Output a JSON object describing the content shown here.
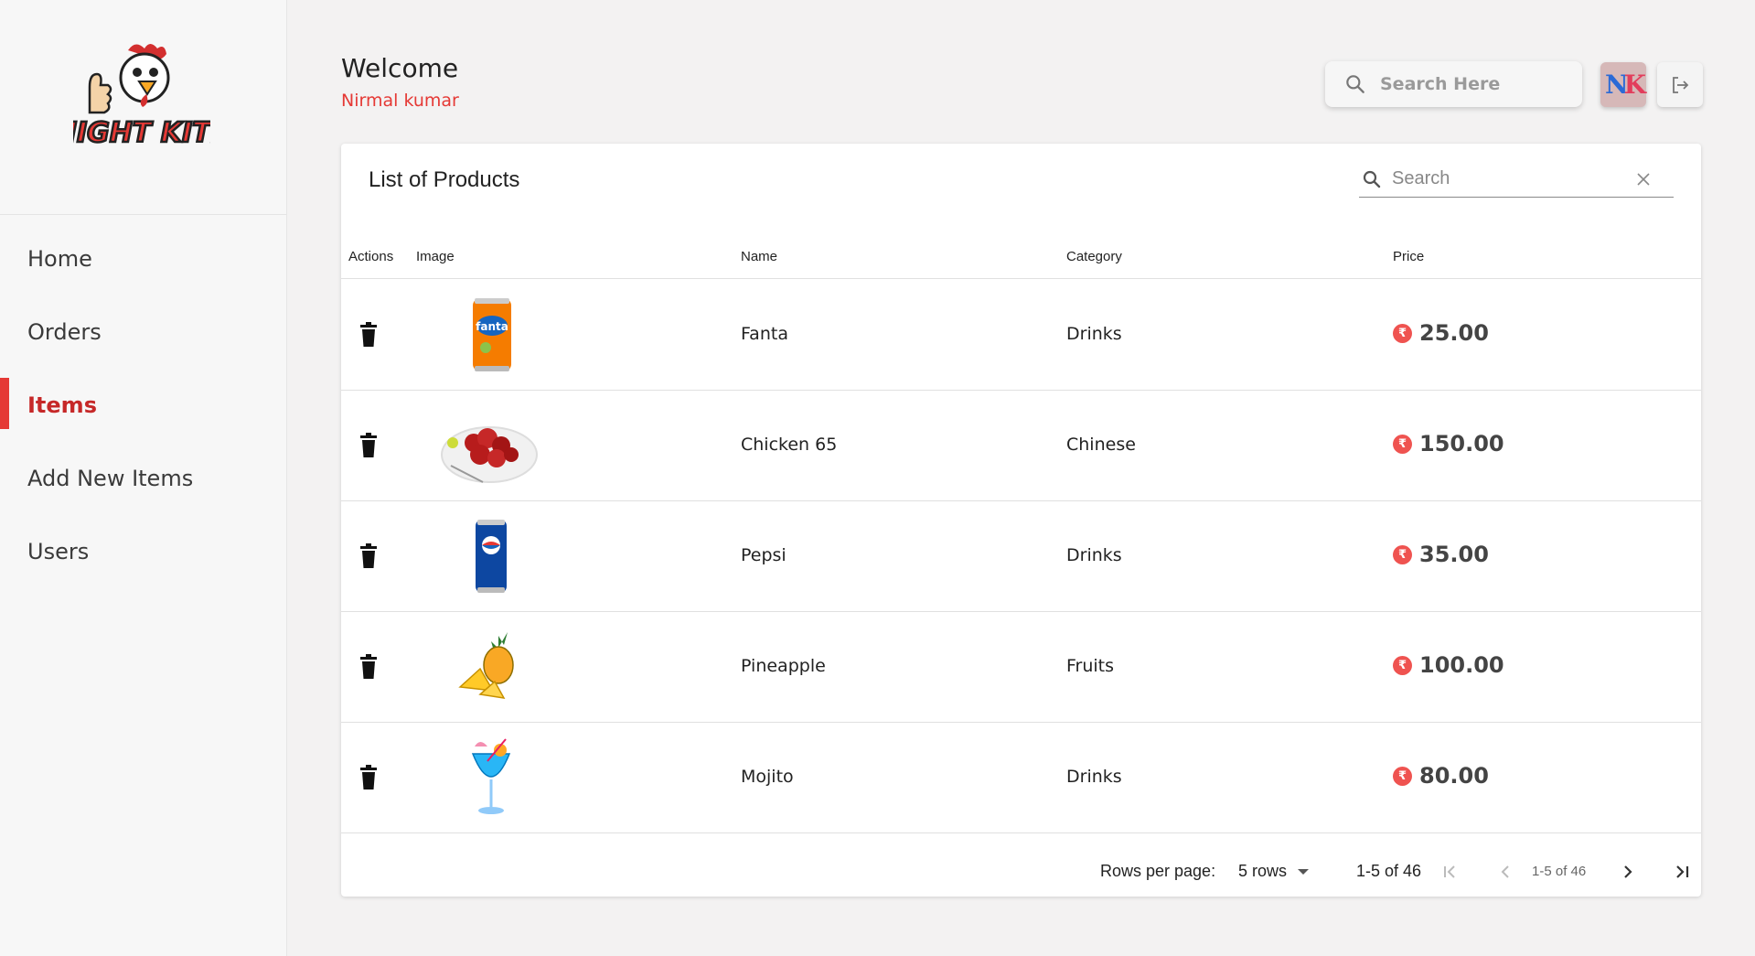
{
  "brand": {
    "logo_text": "NIGHT KITE"
  },
  "sidebar": {
    "items": [
      {
        "label": "Home"
      },
      {
        "label": "Orders"
      },
      {
        "label": "Items",
        "active": true
      },
      {
        "label": "Add New Items"
      },
      {
        "label": "Users"
      }
    ]
  },
  "header": {
    "welcome": "Welcome",
    "user_name": "Nirmal kumar",
    "search_placeholder": "Search Here",
    "avatar_initials": {
      "first": "N",
      "second": "K"
    }
  },
  "products": {
    "title": "List of Products",
    "search_placeholder": "Search",
    "columns": [
      "Actions",
      "Image",
      "Name",
      "Category",
      "Price"
    ],
    "rows": [
      {
        "name": "Fanta",
        "category": "Drinks",
        "price": "25.00",
        "image_icon": "fanta-can-image"
      },
      {
        "name": "Chicken 65",
        "category": "Chinese",
        "price": "150.00",
        "image_icon": "chicken-plate-image"
      },
      {
        "name": "Pepsi",
        "category": "Drinks",
        "price": "35.00",
        "image_icon": "pepsi-can-image"
      },
      {
        "name": "Pineapple",
        "category": "Fruits",
        "price": "100.00",
        "image_icon": "pineapple-image"
      },
      {
        "name": "Mojito",
        "category": "Drinks",
        "price": "80.00",
        "image_icon": "mojito-glass-image"
      }
    ],
    "currency_symbol": "₹",
    "pagination": {
      "rows_per_page_label": "Rows per page:",
      "rows_per_page_value": "5 rows",
      "range": "1-5 of 46",
      "range_small": "1-5 of 46"
    }
  },
  "colors": {
    "accent": "#e53935",
    "active_nav": "#c62828",
    "background": "#f3f2f2"
  }
}
